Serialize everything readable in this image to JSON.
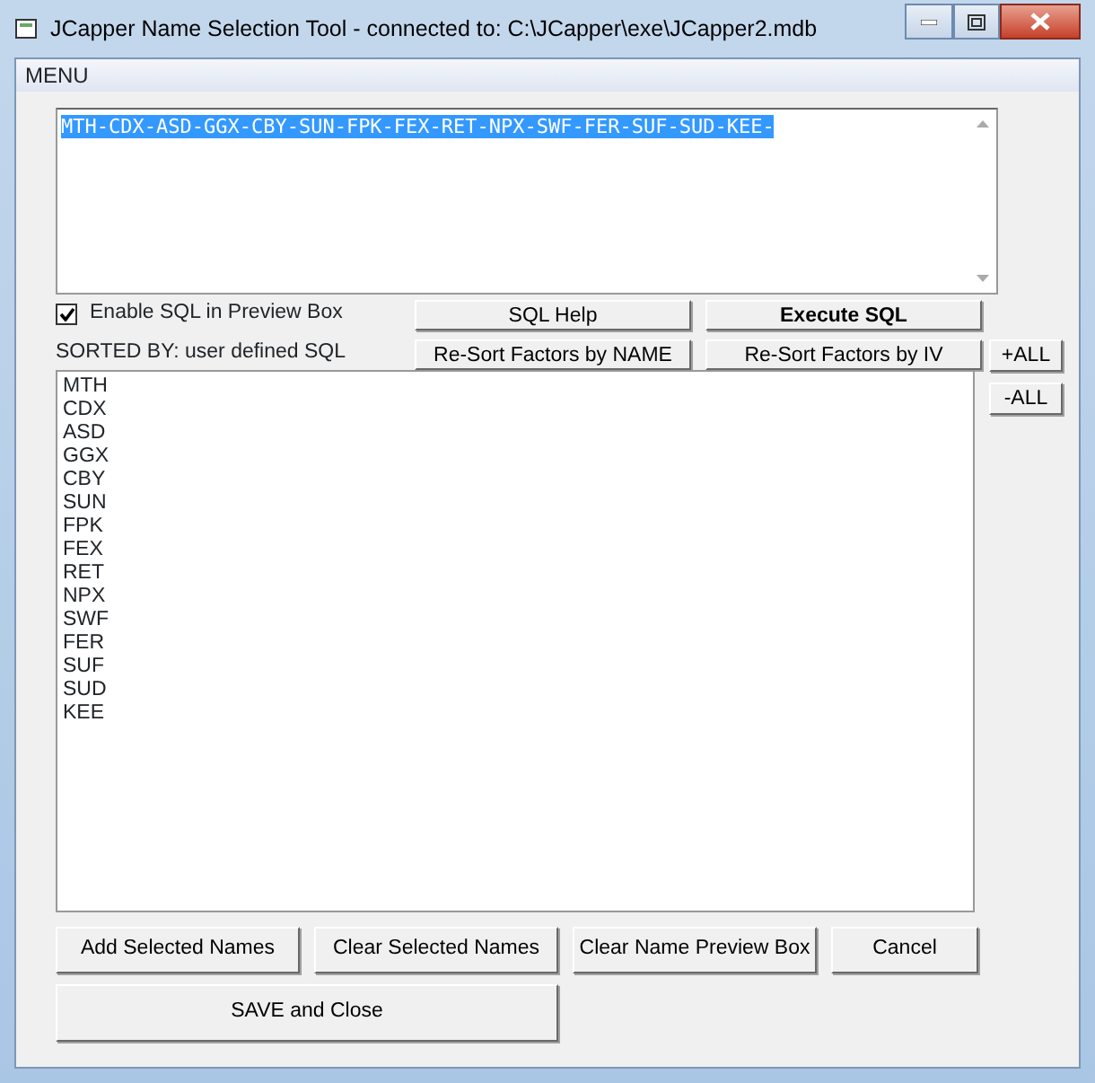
{
  "window": {
    "title": "JCapper Name Selection Tool - connected to: C:\\JCapper\\exe\\JCapper2.mdb"
  },
  "menu": [
    "MENU"
  ],
  "preview": {
    "text": "MTH-CDX-ASD-GGX-CBY-SUN-FPK-FEX-RET-NPX-SWF-FER-SUF-SUD-KEE-",
    "selected": true
  },
  "sql_checkbox": {
    "label": "Enable SQL in Preview Box",
    "checked": true
  },
  "sql_buttons": [
    {
      "label": "SQL Help",
      "bold": false
    },
    {
      "label": "Execute SQL",
      "bold": true
    }
  ],
  "sorted_by": "SORTED BY: user defined SQL",
  "sort_buttons": [
    "Re-Sort Factors by NAME",
    "Re-Sort Factors by IV"
  ],
  "side_buttons": [
    "+ALL",
    "-ALL"
  ],
  "names": [
    "MTH",
    "CDX",
    "ASD",
    "GGX",
    "CBY",
    "SUN",
    "FPK",
    "FEX",
    "RET",
    "NPX",
    "SWF",
    "FER",
    "SUF",
    "SUD",
    "KEE"
  ],
  "action_buttons": [
    "Add Selected Names",
    "Clear Selected Names",
    "Clear Name Preview Box",
    "Cancel"
  ],
  "save_button": "SAVE and Close"
}
